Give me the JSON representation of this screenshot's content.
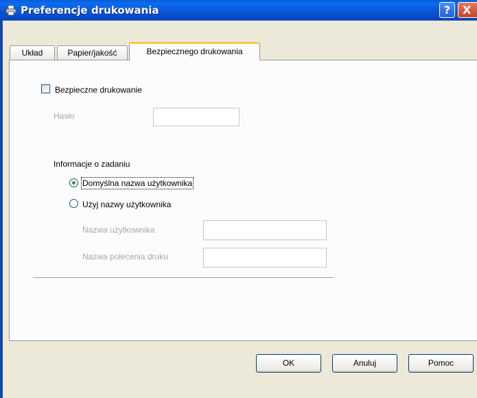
{
  "window": {
    "title": "Preferencje drukowania",
    "help_glyph": "?",
    "close_glyph": "X"
  },
  "tabs": [
    {
      "label": "Układ",
      "active": false
    },
    {
      "label": "Papier/jakość",
      "active": false
    },
    {
      "label": "Bezpiecznego drukowania",
      "active": true
    }
  ],
  "secure": {
    "checkbox_label": "Bezpieczne drukowanie",
    "checked": false,
    "password_label": "Hasło",
    "password_value": ""
  },
  "job_info": {
    "group_label": "Informacje o zadaniu",
    "radio_default_label": "Domyślna nazwa użytkownika",
    "radio_custom_label": "Użyj nazwy użytkownika",
    "selected": "default",
    "username_label": "Nazwa użytkownika",
    "username_value": "",
    "jobname_label": "Nazwa polecenia druku",
    "jobname_value": ""
  },
  "buttons": {
    "ok": "OK",
    "cancel": "Anuluj",
    "help": "Pomoc"
  },
  "colors": {
    "titlebar": "#0b6cf0",
    "dialog_bg": "#ece9d8",
    "active_tab_accent": "#ffc83c",
    "radio_dot": "#21a121",
    "disabled_text": "#a6a6a6"
  },
  "icons": {
    "title": "printer-icon"
  }
}
